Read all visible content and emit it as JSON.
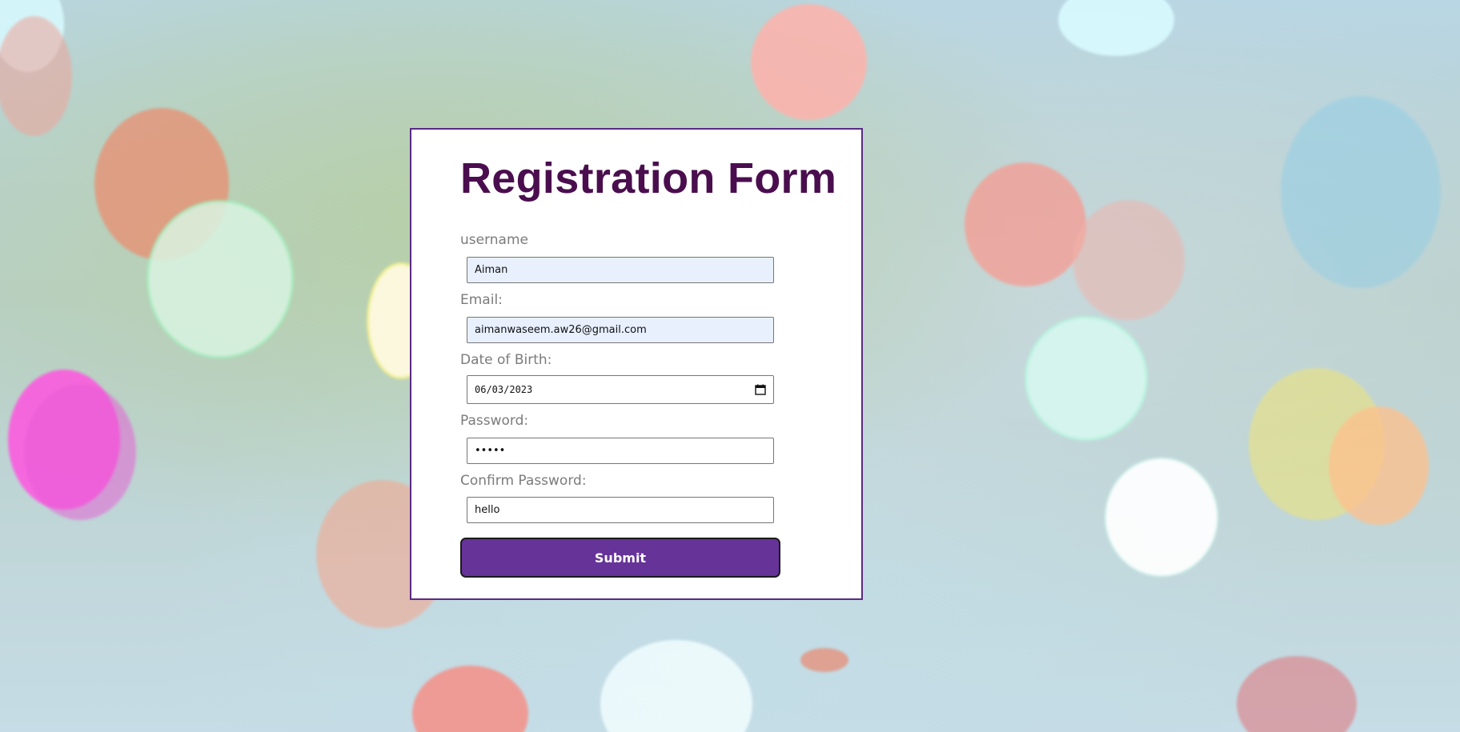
{
  "form": {
    "title": "Registration Form",
    "fields": [
      {
        "label": "username",
        "value": "Aiman"
      },
      {
        "label": "Email:",
        "value": "aimanwaseem.aw26@gmail.com"
      },
      {
        "label": "Date of Birth:",
        "value": "06/03/2023"
      },
      {
        "label": "Password:",
        "value": "•••••"
      },
      {
        "label": "Confirm Password:",
        "value": "hello"
      }
    ],
    "submit_label": "Submit"
  },
  "colors": {
    "title": "#4a0e4e",
    "button_bg": "#663399",
    "card_border": "#5a2a86",
    "autofill_bg": "#e8f0fe",
    "label_text": "#7b7b7b"
  },
  "icons": {
    "date_picker": "calendar-icon"
  }
}
